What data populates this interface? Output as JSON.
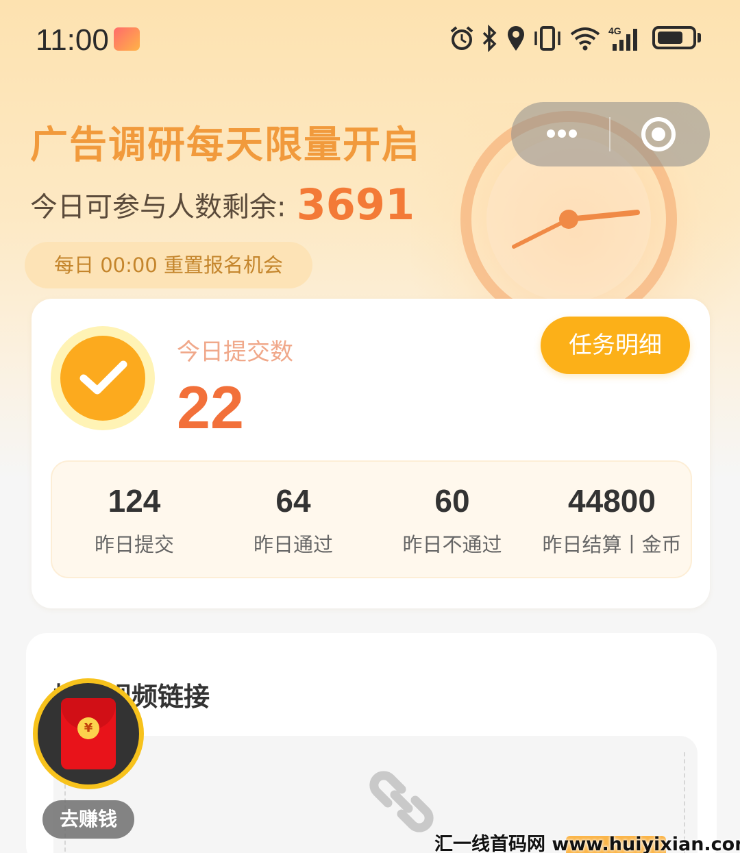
{
  "status_bar": {
    "time": "11:00",
    "battery_level": 0.75,
    "icons": [
      "alarm-icon",
      "bluetooth-icon",
      "location-icon",
      "vibrate-icon",
      "wifi-icon",
      "signal-4g-icon",
      "battery-icon"
    ]
  },
  "capsule": {
    "more": "more-dots-icon",
    "close": "close-target-icon"
  },
  "hero": {
    "title": "广告调研每天限量开启",
    "remain_label": "今日可参与人数剩余:",
    "remain_count": "3691",
    "reset_note": "每日 00:00 重置报名机会"
  },
  "today": {
    "label": "今日提交数",
    "count": "22",
    "detail_button": "任务明细"
  },
  "yesterday": [
    {
      "value": "124",
      "label": "昨日提交"
    },
    {
      "value": "64",
      "label": "昨日通过"
    },
    {
      "value": "60",
      "label": "昨日不通过"
    },
    {
      "value": "44800",
      "label": "昨日结算丨金币"
    }
  ],
  "submit": {
    "title": "提交视频链接"
  },
  "float_button": {
    "label": "去赚钱",
    "coin": "¥"
  },
  "watermark": "汇一线首码网 www.huiyixian.com",
  "colors": {
    "accent": "#fcb018",
    "title_orange": "#f19a3c",
    "count_orange": "#f2703a"
  }
}
